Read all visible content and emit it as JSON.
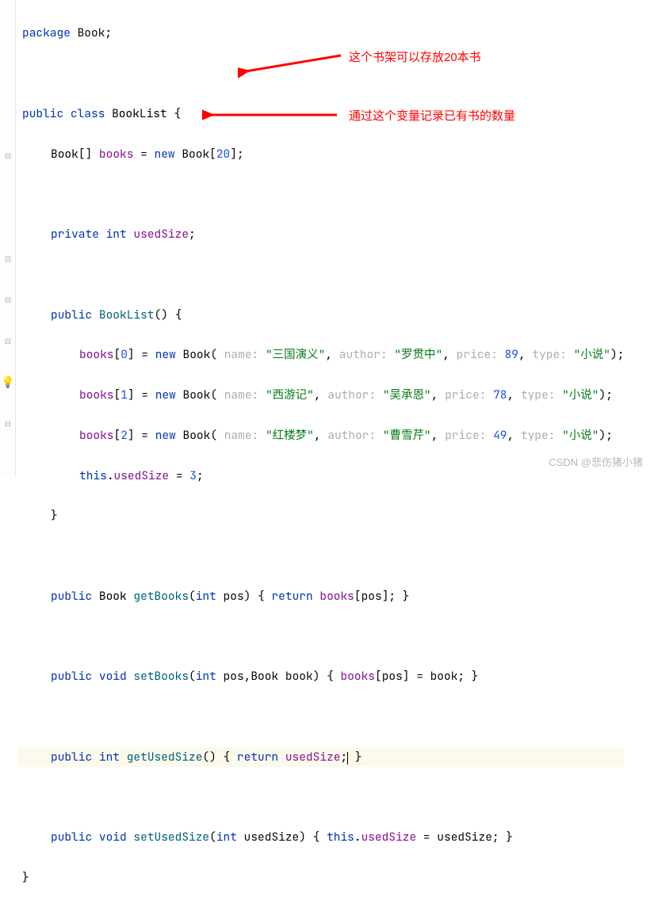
{
  "code": {
    "l1_package": "package",
    "l1_pkgname": "Book",
    "l3_public": "public",
    "l3_class": "class",
    "l3_name": "BookList",
    "l3_brace": "{",
    "l4_type": "Book",
    "l4_arr": "[]",
    "l4_field": "books",
    "l4_eq": " = ",
    "l4_new": "new",
    "l4_ctor": " Book",
    "l4_size": "20",
    "l6_private": "private",
    "l6_int": "int",
    "l6_field": "usedSize",
    "l8_public": "public",
    "l8_ctor": "BookList",
    "l8_parens": "() {",
    "row_idx0": "0",
    "row_idx1": "1",
    "row_idx2": "2",
    "row_new": "new",
    "row_Book": " Book",
    "hint_name": "name:",
    "hint_author": "author:",
    "hint_price": "price:",
    "hint_type": "type:",
    "b0_name": "\"三国演义\"",
    "b0_author": "\"罗贯中\"",
    "b0_price": "89",
    "b0_type": "\"小说\"",
    "b1_name": "\"西游记\"",
    "b1_author": "\"吴承恩\"",
    "b1_price": "78",
    "b1_type": "\"小说\"",
    "b2_name": "\"红楼梦\"",
    "b2_author": "\"曹雪芹\"",
    "b2_price": "49",
    "b2_type": "\"小说\"",
    "l12_this": "this",
    "l12_used": "usedSize",
    "l12_val": "3",
    "l13_close": "}",
    "l15_retType": "Book",
    "l15_name": "getBooks",
    "l15_paramT": "int",
    "l15_paramN": "pos",
    "l15_return": "return",
    "l15_expr_field": "books",
    "l15_expr_idx": "pos",
    "l17_void": "void",
    "l17_name": "setBooks",
    "l17_p1t": "int",
    "l17_p1n": "pos",
    "l17_p2t": "Book",
    "l17_p2n": "book",
    "l19_int": "int",
    "l19_name": "getUsedSize",
    "l19_return": "return",
    "l19_expr": "usedSize",
    "l21_void": "void",
    "l21_name": "setUsedSize",
    "l21_pT": "int",
    "l21_pN": "usedSize",
    "l21_this": "this",
    "l21_field": "usedSize",
    "l21_rhs": "usedSize",
    "l22_close": "}"
  },
  "annotations": {
    "a1": "这个书架可以存放20本书",
    "a2": "通过这个变量记录已有书的数量"
  },
  "watermark": "CSDN @悲伤猪小猪"
}
